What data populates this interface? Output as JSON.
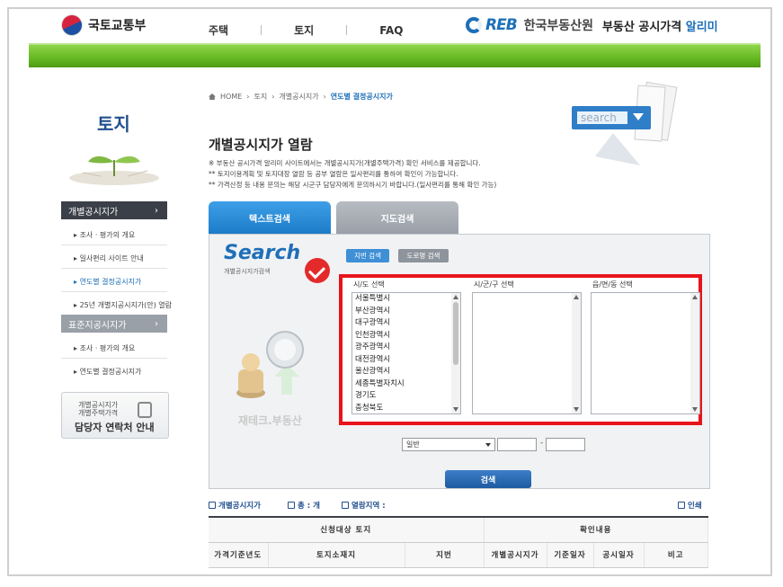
{
  "header": {
    "gov_name": "국토교통부",
    "nav": [
      "주택",
      "토지",
      "FAQ"
    ],
    "reb_logo": "REB",
    "reb_name": "한국부동산원",
    "reb_service": "부동산 공시가격",
    "reb_service_accent": "알리미"
  },
  "sidebar": {
    "title": "토지",
    "group1": "개별공시지가",
    "group1_items": [
      "조사 · 평가의 개요",
      "일사편리 사이트 안내",
      "연도별 결정공시지가",
      "25년 개별지공시지가(안) 열람"
    ],
    "group2": "표준지공시지가",
    "group2_items": [
      "조사 · 평가의 개요",
      "연도별 결정공시지가"
    ],
    "contact_line1": "개별공시지가",
    "contact_line2": "개별주택가격",
    "contact_line3": "담당자 연락처 안내"
  },
  "breadcrumb": [
    "HOME",
    "토지",
    "개별공시지가",
    "연도별 결정공시지가"
  ],
  "page_title": "개별공시지가 열람",
  "notices": [
    "※ 부동산 공시가격 알리미 사이트에서는 개별공시지가(개별주택가격) 확인 서비스를 제공합니다.",
    "** 토지이용계획 및 토지대장 열람 등 공부 열람은 일사편리를 통하여 확인이 가능합니다.",
    "** 가격산정 등 내용 문의는 해당 시군구 담당자에게 문의하시기 바랍니다.(일사편리를 통해 확인 가능)"
  ],
  "illustration_word": "search",
  "tabs": [
    "텍스트검색",
    "지도검색"
  ],
  "search": {
    "logo": "Search",
    "logo_sub": "개별공시지가검색",
    "btn_jibun": "지번 검색",
    "btn_road": "도로명 검색",
    "col_sido": "시/도 선택",
    "col_sigungu": "시/군/구 선택",
    "col_dong": "읍/면/동 선택",
    "sido_options": [
      "서울특별시",
      "부산광역시",
      "대구광역시",
      "인천광역시",
      "광주광역시",
      "대전광역시",
      "울산광역시",
      "세종특별자치시",
      "경기도",
      "충청북도"
    ],
    "type_select": "일반",
    "dash": "-",
    "submit": "검색",
    "watermark": "재테크.부동산"
  },
  "info": {
    "label1": "개별공시지가",
    "label2": "총 : 개",
    "label3": "열람지역 :",
    "print": "인쇄"
  },
  "table": {
    "group1": "신청대상 토지",
    "group2": "확인내용",
    "headers": [
      "가격기준년도",
      "토지소재지",
      "지번",
      "개별공시지가",
      "기준일자",
      "공시일자",
      "비고"
    ]
  }
}
